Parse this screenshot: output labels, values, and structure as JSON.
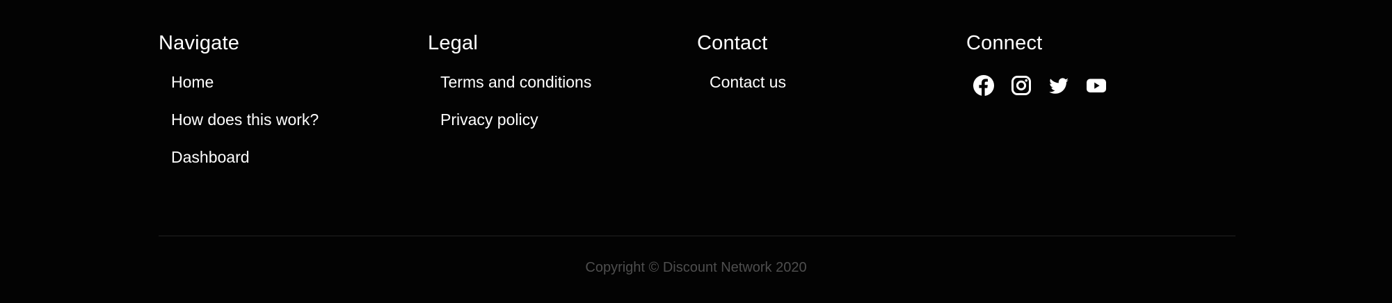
{
  "footer": {
    "columns": [
      {
        "heading": "Navigate",
        "links": [
          "Home",
          "How does this work?",
          "Dashboard"
        ]
      },
      {
        "heading": "Legal",
        "links": [
          "Terms and conditions",
          "Privacy policy"
        ]
      },
      {
        "heading": "Contact",
        "links": [
          "Contact us"
        ]
      },
      {
        "heading": "Connect",
        "social_icons": [
          "facebook-icon",
          "instagram-icon",
          "twitter-icon",
          "youtube-icon"
        ]
      }
    ],
    "copyright": "Copyright © Discount Network 2020"
  },
  "colors": {
    "background": "#030303",
    "text": "#ffffff",
    "copyright": "#4e4e4e",
    "divider": "#222222"
  }
}
